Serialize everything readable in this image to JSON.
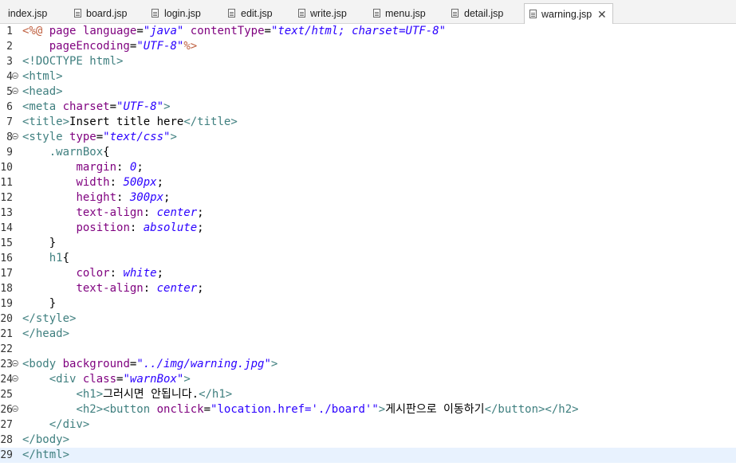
{
  "tabs": [
    {
      "label": "index.jsp",
      "active": false
    },
    {
      "label": "board.jsp",
      "active": false
    },
    {
      "label": "login.jsp",
      "active": false
    },
    {
      "label": "edit.jsp",
      "active": false
    },
    {
      "label": "write.jsp",
      "active": false
    },
    {
      "label": "menu.jsp",
      "active": false
    },
    {
      "label": "detail.jsp",
      "active": false
    },
    {
      "label": "warning.jsp",
      "active": true
    }
  ],
  "close_glyph": "✕",
  "current_line": 29,
  "colors": {
    "directive": "#bf5f3f",
    "tag": "#3f7f7f",
    "attribute": "#7f007f",
    "string": "#2a00ff",
    "current_line_bg": "#e8f2fe"
  },
  "lines": [
    {
      "n": "1",
      "fold": false,
      "tokens": [
        [
          "dir",
          "<%@"
        ],
        [
          "plain",
          " "
        ],
        [
          "attr",
          "page"
        ],
        [
          "plain",
          " "
        ],
        [
          "attr",
          "language"
        ],
        [
          "plain",
          "="
        ],
        [
          "str",
          "\"java\""
        ],
        [
          "plain",
          " "
        ],
        [
          "attr",
          "contentType"
        ],
        [
          "plain",
          "="
        ],
        [
          "str",
          "\"text/html; charset=UTF-8\""
        ]
      ]
    },
    {
      "n": "2",
      "fold": false,
      "tokens": [
        [
          "plain",
          "    "
        ],
        [
          "attr",
          "pageEncoding"
        ],
        [
          "plain",
          "="
        ],
        [
          "str",
          "\"UTF-8\""
        ],
        [
          "dir",
          "%>"
        ]
      ]
    },
    {
      "n": "3",
      "fold": false,
      "tokens": [
        [
          "tag",
          "<!DOCTYPE html>"
        ]
      ]
    },
    {
      "n": "4",
      "fold": true,
      "tokens": [
        [
          "tag",
          "<html>"
        ]
      ]
    },
    {
      "n": "5",
      "fold": true,
      "tokens": [
        [
          "tag",
          "<head>"
        ]
      ]
    },
    {
      "n": "6",
      "fold": false,
      "tokens": [
        [
          "tag",
          "<meta"
        ],
        [
          "plain",
          " "
        ],
        [
          "attr",
          "charset"
        ],
        [
          "plain",
          "="
        ],
        [
          "str",
          "\"UTF-8\""
        ],
        [
          "tag",
          ">"
        ]
      ]
    },
    {
      "n": "7",
      "fold": false,
      "tokens": [
        [
          "tag",
          "<title>"
        ],
        [
          "text",
          "Insert title here"
        ],
        [
          "tag",
          "</title>"
        ]
      ]
    },
    {
      "n": "8",
      "fold": true,
      "tokens": [
        [
          "tag",
          "<style"
        ],
        [
          "plain",
          " "
        ],
        [
          "attr",
          "type"
        ],
        [
          "plain",
          "="
        ],
        [
          "str",
          "\"text/css\""
        ],
        [
          "tag",
          ">"
        ]
      ]
    },
    {
      "n": "9",
      "fold": false,
      "tokens": [
        [
          "plain",
          "    "
        ],
        [
          "tag",
          ".warnBox"
        ],
        [
          "plain",
          "{"
        ]
      ]
    },
    {
      "n": "10",
      "fold": false,
      "tokens": [
        [
          "plain",
          "        "
        ],
        [
          "cssprop",
          "margin"
        ],
        [
          "plain",
          ": "
        ],
        [
          "cssval",
          "0"
        ],
        [
          "plain",
          ";"
        ]
      ]
    },
    {
      "n": "11",
      "fold": false,
      "tokens": [
        [
          "plain",
          "        "
        ],
        [
          "cssprop",
          "width"
        ],
        [
          "plain",
          ": "
        ],
        [
          "cssval",
          "500px"
        ],
        [
          "plain",
          ";"
        ]
      ]
    },
    {
      "n": "12",
      "fold": false,
      "tokens": [
        [
          "plain",
          "        "
        ],
        [
          "cssprop",
          "height"
        ],
        [
          "plain",
          ": "
        ],
        [
          "cssval",
          "300px"
        ],
        [
          "plain",
          ";"
        ]
      ]
    },
    {
      "n": "13",
      "fold": false,
      "tokens": [
        [
          "plain",
          "        "
        ],
        [
          "cssprop",
          "text-align"
        ],
        [
          "plain",
          ": "
        ],
        [
          "cssval",
          "center"
        ],
        [
          "plain",
          ";"
        ]
      ]
    },
    {
      "n": "14",
      "fold": false,
      "tokens": [
        [
          "plain",
          "        "
        ],
        [
          "cssprop",
          "position"
        ],
        [
          "plain",
          ": "
        ],
        [
          "cssval",
          "absolute"
        ],
        [
          "plain",
          ";"
        ]
      ]
    },
    {
      "n": "15",
      "fold": false,
      "tokens": [
        [
          "plain",
          "    }"
        ]
      ]
    },
    {
      "n": "16",
      "fold": false,
      "tokens": [
        [
          "plain",
          "    "
        ],
        [
          "tag",
          "h1"
        ],
        [
          "plain",
          "{"
        ]
      ]
    },
    {
      "n": "17",
      "fold": false,
      "tokens": [
        [
          "plain",
          "        "
        ],
        [
          "cssprop",
          "color"
        ],
        [
          "plain",
          ": "
        ],
        [
          "cssval",
          "white"
        ],
        [
          "plain",
          ";"
        ]
      ]
    },
    {
      "n": "18",
      "fold": false,
      "tokens": [
        [
          "plain",
          "        "
        ],
        [
          "cssprop",
          "text-align"
        ],
        [
          "plain",
          ": "
        ],
        [
          "cssval",
          "center"
        ],
        [
          "plain",
          ";"
        ]
      ]
    },
    {
      "n": "19",
      "fold": false,
      "tokens": [
        [
          "plain",
          "    }"
        ]
      ]
    },
    {
      "n": "20",
      "fold": false,
      "tokens": [
        [
          "tag",
          "</style>"
        ]
      ]
    },
    {
      "n": "21",
      "fold": false,
      "tokens": [
        [
          "tag",
          "</head>"
        ]
      ]
    },
    {
      "n": "22",
      "fold": false,
      "tokens": []
    },
    {
      "n": "23",
      "fold": true,
      "tokens": [
        [
          "tag",
          "<body"
        ],
        [
          "plain",
          " "
        ],
        [
          "attr",
          "background"
        ],
        [
          "plain",
          "="
        ],
        [
          "str",
          "\"../img/warning.jpg\""
        ],
        [
          "tag",
          ">"
        ]
      ]
    },
    {
      "n": "24",
      "fold": true,
      "tokens": [
        [
          "plain",
          "    "
        ],
        [
          "tag",
          "<div"
        ],
        [
          "plain",
          " "
        ],
        [
          "attr",
          "class"
        ],
        [
          "plain",
          "="
        ],
        [
          "str",
          "\"warnBox\""
        ],
        [
          "tag",
          ">"
        ]
      ]
    },
    {
      "n": "25",
      "fold": false,
      "tokens": [
        [
          "plain",
          "        "
        ],
        [
          "tag",
          "<h1>"
        ],
        [
          "text",
          "그러시면 안됩니다."
        ],
        [
          "tag",
          "</h1>"
        ]
      ]
    },
    {
      "n": "26",
      "fold": true,
      "tokens": [
        [
          "plain",
          "        "
        ],
        [
          "tag",
          "<h2><button"
        ],
        [
          "plain",
          " "
        ],
        [
          "attr",
          "onclick"
        ],
        [
          "plain",
          "="
        ],
        [
          "str2",
          "\"location.href='./board'\""
        ],
        [
          "tag",
          ">"
        ],
        [
          "text",
          "게시판으로 이동하기"
        ],
        [
          "tag",
          "</button></h2>"
        ]
      ]
    },
    {
      "n": "27",
      "fold": false,
      "tokens": [
        [
          "plain",
          "    "
        ],
        [
          "tag",
          "</div>"
        ]
      ]
    },
    {
      "n": "28",
      "fold": false,
      "tokens": [
        [
          "tag",
          "</body>"
        ]
      ]
    },
    {
      "n": "29",
      "fold": false,
      "tokens": [
        [
          "tag",
          "</html>"
        ]
      ]
    }
  ]
}
